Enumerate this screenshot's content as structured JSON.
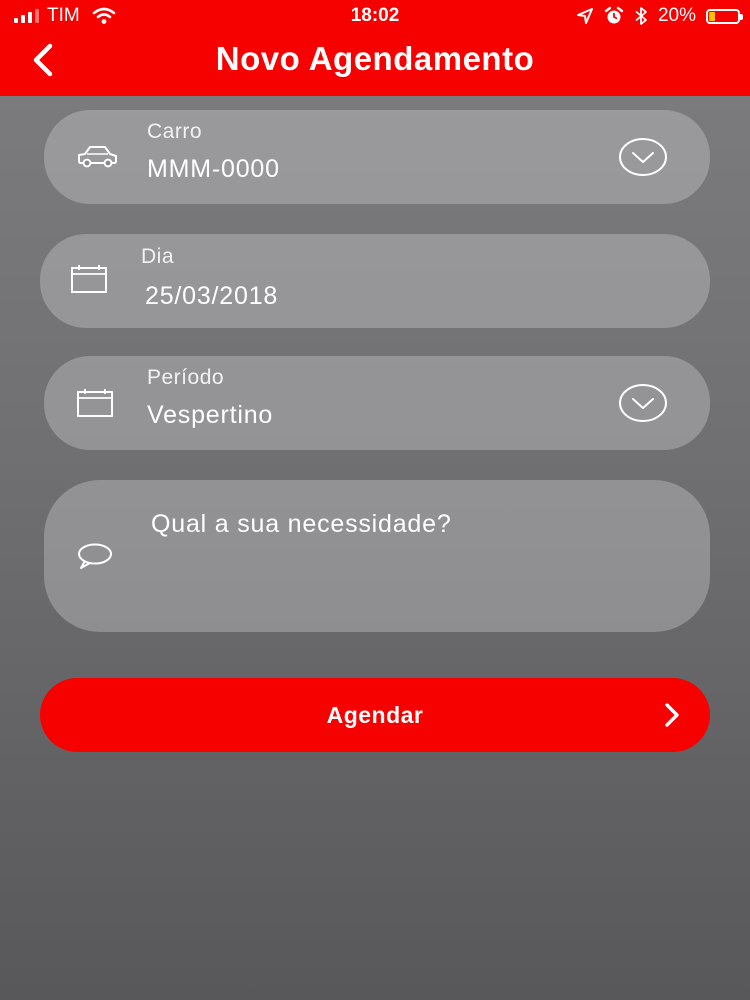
{
  "status_bar": {
    "carrier": "TIM",
    "time": "18:02",
    "battery_percent": "20%",
    "battery_level": 0.2
  },
  "header": {
    "title": "Novo Agendamento",
    "color": "#f70000"
  },
  "form": {
    "carro": {
      "label": "Carro",
      "value": "MMM-0000",
      "icon": "car-icon"
    },
    "dia": {
      "label": "Dia",
      "value": "25/03/2018",
      "icon": "calendar-icon"
    },
    "periodo": {
      "label": "Período",
      "value": "Vespertino",
      "icon": "calendar-icon"
    },
    "necessidade": {
      "placeholder": "Qual a sua necessidade?",
      "icon": "speech-bubble-icon"
    }
  },
  "submit": {
    "label": "Agendar",
    "color": "#f70000"
  }
}
